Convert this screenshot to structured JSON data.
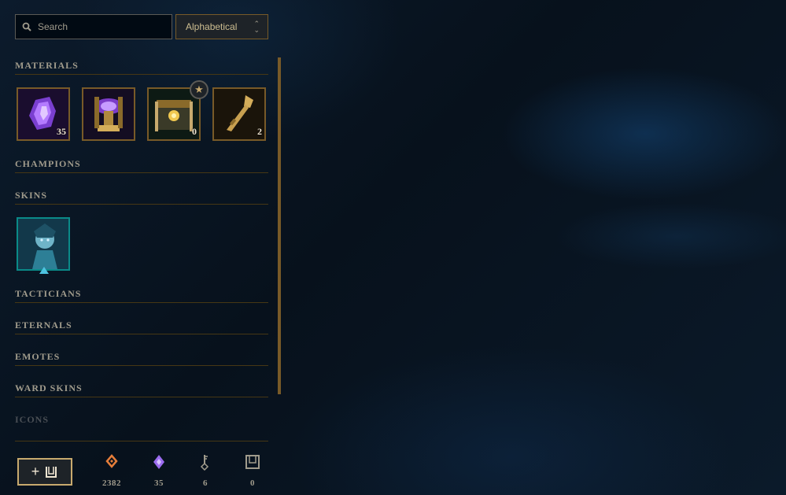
{
  "search": {
    "placeholder": "Search"
  },
  "sort": {
    "selected": "Alphabetical"
  },
  "sections": {
    "materials": "MATERIALS",
    "champions": "CHAMPIONS",
    "skins": "SKINS",
    "tacticians": "TACTICIANS",
    "eternals": "ETERNALS",
    "emotes": "EMOTES",
    "ward_skins": "WARD SKINS",
    "icons": "ICONS"
  },
  "materials": [
    {
      "icon": "gemstone-icon",
      "count": "35"
    },
    {
      "icon": "chalice-icon",
      "count": ""
    },
    {
      "icon": "chest-icon",
      "count": "0"
    },
    {
      "icon": "key-icon",
      "count": "2"
    }
  ],
  "skins": [
    {
      "icon": "champion-skin-portrait"
    }
  ],
  "footer": {
    "craft_label": "+",
    "currencies": [
      {
        "icon": "blue-essence-icon",
        "value": "2382",
        "color": "#e67e3a"
      },
      {
        "icon": "mythic-essence-icon",
        "value": "35",
        "color": "#9b6cf0"
      },
      {
        "icon": "key-fragment-icon",
        "value": "6",
        "color": "#a09b8c"
      },
      {
        "icon": "chest-currency-icon",
        "value": "0",
        "color": "#a09b8c"
      }
    ]
  },
  "colors": {
    "gold": "#c8aa6e",
    "border_gold": "#785a28",
    "text": "#a09b8c",
    "teal": "#0a8a88"
  }
}
